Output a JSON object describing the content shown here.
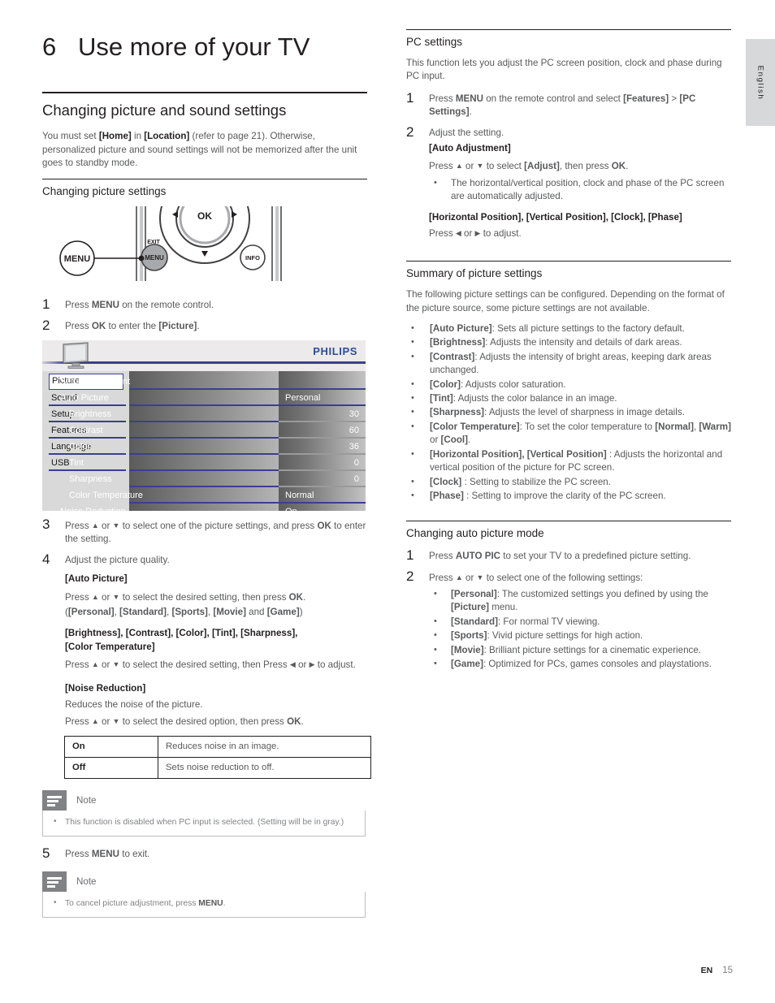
{
  "page": {
    "chapter_number": "6",
    "chapter_title": "Use more of your TV",
    "language_tab": "English",
    "footer_lang": "EN",
    "footer_page": "15"
  },
  "left": {
    "section_title": "Changing picture and sound settings",
    "intro": "You must set [Home] in [Location] (refer to page 21). Otherwise, personalized picture and sound settings will not be memorized after the unit goes to standby mode.",
    "intro_parts": {
      "p1": "You must set ",
      "b1": "[Home]",
      "p2": " in ",
      "b2": "[Location]",
      "p3": " (refer to page 21). Otherwise, personalized picture and sound settings will not be memorized after the unit goes to standby mode."
    },
    "sub_title": "Changing picture settings",
    "remote": {
      "callout_label": "MENU",
      "ok_label": "OK",
      "exit_label": "EXIT",
      "menu_button_label": "MENU",
      "info_label": "INFO"
    },
    "step1": {
      "num": "1",
      "a": "Press ",
      "b": "MENU",
      "c": " on the remote control."
    },
    "step2": {
      "num": "2",
      "a": "Press ",
      "b": "OK",
      "c": " to enter the ",
      "d": "[Picture]",
      "e": "."
    },
    "tv_menu": {
      "brand": "PHILIPS",
      "sidebar": [
        "Picture",
        "Sound",
        "Setup",
        "Features",
        "Language",
        "USB"
      ],
      "selected_sidebar": "Picture",
      "rows": [
        {
          "label": "Settings assistant",
          "value": "",
          "indent": false
        },
        {
          "label": "Auto Picture",
          "value": "Personal",
          "indent": false,
          "align": "left"
        },
        {
          "label": "Brightness",
          "value": "30",
          "indent": true,
          "align": "right"
        },
        {
          "label": "Contrast",
          "value": "60",
          "indent": true,
          "align": "right"
        },
        {
          "label": "Color",
          "value": "36",
          "indent": true,
          "align": "right"
        },
        {
          "label": "Tint",
          "value": "0",
          "indent": true,
          "align": "right"
        },
        {
          "label": "Sharpness",
          "value": "0",
          "indent": true,
          "align": "right"
        },
        {
          "label": "Color Temperature",
          "value": "Normal",
          "indent": true,
          "align": "left"
        },
        {
          "label": "Noise Reduction",
          "value": "On",
          "indent": false,
          "align": "left"
        }
      ]
    },
    "step3": {
      "num": "3",
      "a": "Press ",
      "up": "▲",
      "b": " or ",
      "down": "▼",
      "c": " to select one of the picture settings, and press ",
      "d": "OK",
      "e": " to enter the setting."
    },
    "step4": {
      "num": "4",
      "line1": "Adjust the picture quality.",
      "head1": "[Auto Picture]",
      "l2a": "Press ",
      "l2b": " or ",
      "l2c": " to select the desired setting, then press ",
      "l2d": "OK",
      "l2e": ".",
      "l3": "([Personal], [Standard], [Sports], [Movie] and [Game])",
      "l3_parts": {
        "o": "(",
        "a": "[Personal]",
        "s1": ", ",
        "b": "[Standard]",
        "s2": ", ",
        "c": "[Sports]",
        "s3": ", ",
        "d": "[Movie]",
        "s4": " and ",
        "e": "[Game]",
        "cl": ")"
      },
      "head2a": "[Brightness], [Contrast], [Color], [Tint], [Sharpness],",
      "head2b": "[Color Temperature]",
      "l4a": "Press ",
      "l4b": " or ",
      "l4c": " to select the desired setting, then Press ",
      "l4d": " or ",
      "l4e": " to adjust.",
      "head3": "[Noise Reduction]",
      "l5": "Reduces the noise of the picture.",
      "l6a": "Press ",
      "l6b": " or ",
      "l6c": " to select the desired option, then press ",
      "l6d": "OK",
      "l6e": "."
    },
    "onoff_table": {
      "rows": [
        {
          "key": "On",
          "desc": "Reduces noise in an image."
        },
        {
          "key": "Off",
          "desc": "Sets noise reduction to off."
        }
      ]
    },
    "note1": {
      "label": "Note",
      "text": "This function is disabled when PC input is selected. (Setting will be in gray.)"
    },
    "step5": {
      "num": "5",
      "a": "Press ",
      "b": "MENU",
      "c": " to exit."
    },
    "note2": {
      "label": "Note",
      "pre": "To cancel picture adjustment, press ",
      "bold": "MENU",
      "post": "."
    }
  },
  "right": {
    "pc_settings": {
      "title": "PC settings",
      "intro": "This function lets you adjust the PC screen position, clock and phase during PC input.",
      "step1": {
        "num": "1",
        "a": "Press ",
        "b": "MENU",
        "c": " on the remote control and select ",
        "d": "[Features]",
        "e": " >  ",
        "f": "[PC Settings]",
        "g": "."
      },
      "step2": {
        "num": "2",
        "line1": "Adjust the setting.",
        "head1": "[Auto Adjustment]",
        "l2a": "Press ",
        "l2b": " or ",
        "l2c": " to select ",
        "l2d": "[Adjust]",
        "l2e": ", then press ",
        "l2f": "OK",
        "l2g": ".",
        "bullet": "The horizontal/vertical position, clock and phase of the PC screen are automatically adjusted.",
        "head2": "[Horizontal Position], [Vertical Position], [Clock], [Phase]",
        "l3a": "Press ",
        "l3b": " or ",
        "l3c": " to adjust."
      }
    },
    "summary": {
      "title": "Summary of picture settings",
      "intro": "The following picture settings can be configured. Depending on the format of the picture source, some picture settings are not available.",
      "items": [
        {
          "term": "[Auto Picture]",
          "desc": ": Sets all picture settings to the factory default."
        },
        {
          "term": "[Brightness]",
          "desc": ": Adjusts the intensity and details of dark areas."
        },
        {
          "term": "[Contrast]",
          "desc": ": Adjusts the intensity of bright areas, keeping dark areas unchanged."
        },
        {
          "term": "[Color]",
          "desc": ": Adjusts color saturation."
        },
        {
          "term": "[Tint]",
          "desc": ": Adjusts the color balance in an image."
        },
        {
          "term": "[Sharpness]",
          "desc": ": Adjusts the level of sharpness in image details."
        },
        {
          "term": "[Color Temperature]",
          "desc": ": To set the color temperature to [Normal], [Warm] or [Cool]."
        },
        {
          "term": "[Horizontal Position], [Vertical Position]",
          "desc": " : Adjusts the horizontal and vertical position of the picture for PC screen."
        },
        {
          "term": "[Clock]",
          "desc": " : Setting to stabilize the PC screen."
        },
        {
          "term": "[Phase]",
          "desc": " : Setting to improve the clarity of the PC screen."
        }
      ],
      "color_temp_parts": {
        "pre": ": To set the color temperature to ",
        "n": "[Normal]",
        "s1": ", ",
        "w": "[Warm]",
        "s2": " or ",
        "c": "[Cool]",
        "end": "."
      }
    },
    "auto_picture_mode": {
      "title": "Changing auto picture mode",
      "step1": {
        "num": "1",
        "a": "Press ",
        "b": "AUTO PIC",
        "c": " to set your TV to a predefined picture setting."
      },
      "step2": {
        "num": "2",
        "a": "Press ",
        "b": " or ",
        "c": " to select one of the following settings:"
      },
      "items": [
        {
          "term": "[Personal]",
          "desc": ": The customized settings you defined by using the [Picture] menu."
        },
        {
          "term": "[Standard]",
          "desc": ": For normal TV viewing."
        },
        {
          "term": "[Sports]",
          "desc": ": Vivid picture settings for high action."
        },
        {
          "term": "[Movie]",
          "desc": ": Brilliant picture settings for a cinematic experience."
        },
        {
          "term": "[Game]",
          "desc": ": Optimized for PCs, games consoles and playstations."
        }
      ],
      "personal_parts": {
        "a": ": The customized settings you defined by using the ",
        "b": "[Picture]",
        "c": " menu."
      }
    }
  },
  "colors": {
    "ink": "#231f20",
    "body": "#58595b",
    "philips_blue": "#2e4ba0",
    "menu_blue": "#3b3f8f",
    "note_gray": "#808285"
  }
}
